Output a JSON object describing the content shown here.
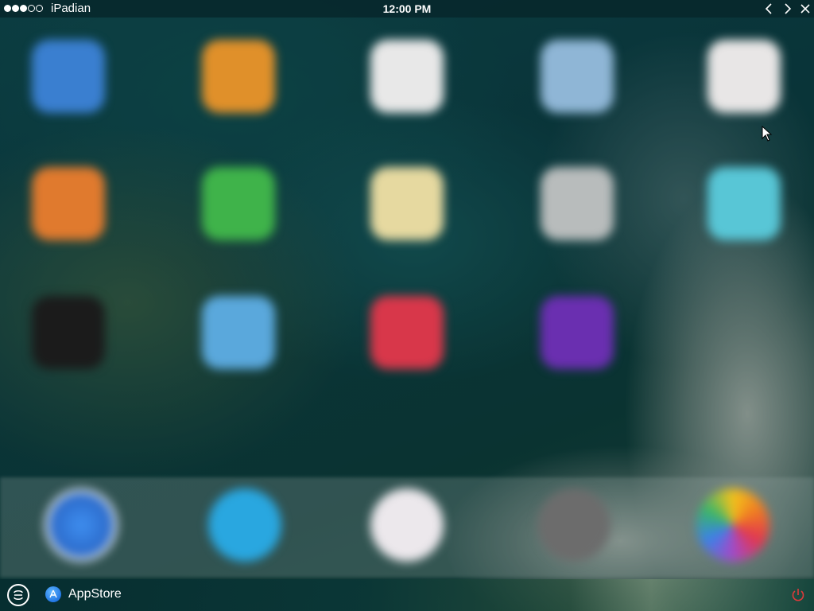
{
  "title_bar": {
    "app_name": "iPadian",
    "time": "12:00 PM",
    "signal": {
      "bars_filled": 3,
      "bars_total": 5
    },
    "buttons": [
      {
        "name": "back",
        "icon": "chevron-left-icon"
      },
      {
        "name": "forward",
        "icon": "chevron-right-icon"
      },
      {
        "name": "close",
        "icon": "close-icon"
      }
    ]
  },
  "home_screen": {
    "rows": [
      [
        {
          "icon": "blue-app-icon",
          "color": "#3a7fd0"
        },
        {
          "icon": "orange-app-icon",
          "color": "#e0902a"
        },
        {
          "icon": "clock-app-icon",
          "color": "#e8e8e8"
        },
        {
          "icon": "light-blue-app-icon",
          "color": "#8fb6d6"
        },
        {
          "icon": "red-white-app-icon",
          "color": "#e8e6e6"
        }
      ],
      [
        {
          "icon": "orange-app-icon",
          "color": "#e07a2e"
        },
        {
          "icon": "green-app-icon",
          "color": "#3fb34a"
        },
        {
          "icon": "notes-app-icon",
          "color": "#e6d9a0"
        },
        {
          "icon": "grey-app-icon",
          "color": "#b8bcbc"
        },
        {
          "icon": "cyan-app-icon",
          "color": "#58c6d6"
        }
      ],
      [
        {
          "icon": "black-app-icon",
          "color": "#1b1b1b"
        },
        {
          "icon": "weather-app-icon",
          "color": "#5aa8dc"
        },
        {
          "icon": "red-app-icon",
          "color": "#d8374a"
        },
        {
          "icon": "purple-app-icon",
          "color": "#6a2fb0"
        }
      ]
    ],
    "dock": [
      {
        "icon": "safari-icon",
        "color": "#2f7fe0"
      },
      {
        "icon": "mail-icon",
        "color": "#29a7e0"
      },
      {
        "icon": "music-icon",
        "color": "#ece8ec"
      },
      {
        "icon": "settings-icon",
        "color": "#6c6c6c"
      },
      {
        "icon": "photos-icon",
        "color": "#f0f0f0"
      }
    ]
  },
  "taskbar": {
    "home_icon": "home-circle-icon",
    "appstore_label": "AppStore",
    "appstore_icon": "appstore-icon",
    "power_icon": "power-icon",
    "power_color": "#e03a3a"
  }
}
